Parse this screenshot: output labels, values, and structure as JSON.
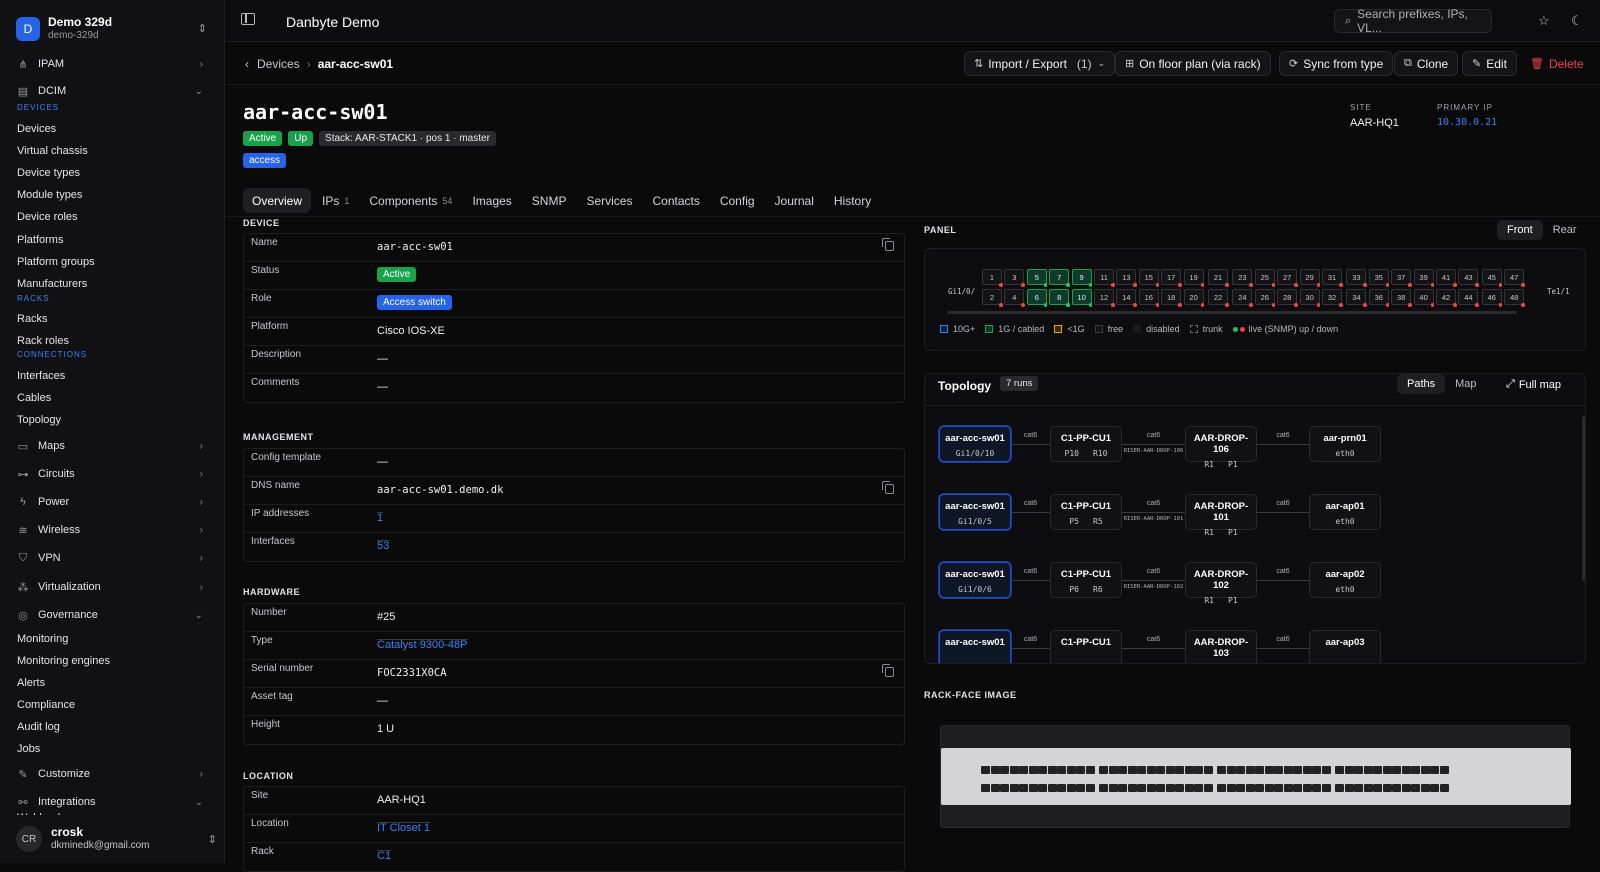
{
  "org": {
    "name": "Demo 329d",
    "slug": "demo-329d",
    "initial": "D"
  },
  "sidebar": {
    "items": [
      {
        "label": "IPAM",
        "icon": "ipam-icon",
        "type": "top",
        "chevron": "right"
      },
      {
        "label": "DCIM",
        "icon": "server-icon",
        "type": "top",
        "chevron": "down"
      },
      {
        "label": "DEVICES",
        "type": "section"
      },
      {
        "label": "Devices",
        "type": "sub"
      },
      {
        "label": "Virtual chassis",
        "type": "sub"
      },
      {
        "label": "Device types",
        "type": "sub"
      },
      {
        "label": "Module types",
        "type": "sub"
      },
      {
        "label": "Device roles",
        "type": "sub"
      },
      {
        "label": "Platforms",
        "type": "sub"
      },
      {
        "label": "Platform groups",
        "type": "sub"
      },
      {
        "label": "Manufacturers",
        "type": "sub"
      },
      {
        "label": "RACKS",
        "type": "section"
      },
      {
        "label": "Racks",
        "type": "sub"
      },
      {
        "label": "Rack roles",
        "type": "sub"
      },
      {
        "label": "CONNECTIONS",
        "type": "section"
      },
      {
        "label": "Interfaces",
        "type": "sub"
      },
      {
        "label": "Cables",
        "type": "sub"
      },
      {
        "label": "Topology",
        "type": "sub"
      },
      {
        "label": "Maps",
        "icon": "map-icon",
        "type": "top",
        "chevron": "right"
      },
      {
        "label": "Circuits",
        "icon": "circuit-icon",
        "type": "top",
        "chevron": "right"
      },
      {
        "label": "Power",
        "icon": "power-icon",
        "type": "top",
        "chevron": "right"
      },
      {
        "label": "Wireless",
        "icon": "wireless-icon",
        "type": "top",
        "chevron": "right"
      },
      {
        "label": "VPN",
        "icon": "shield-icon",
        "type": "top",
        "chevron": "right"
      },
      {
        "label": "Virtualization",
        "icon": "cluster-icon",
        "type": "top",
        "chevron": "right"
      },
      {
        "label": "Governance",
        "icon": "governance-icon",
        "type": "top",
        "chevron": "down"
      },
      {
        "label": "Monitoring",
        "type": "sub"
      },
      {
        "label": "Monitoring engines",
        "type": "sub"
      },
      {
        "label": "Alerts",
        "type": "sub"
      },
      {
        "label": "Compliance",
        "type": "sub"
      },
      {
        "label": "Audit log",
        "type": "sub"
      },
      {
        "label": "Jobs",
        "type": "sub"
      },
      {
        "label": "Customize",
        "icon": "customize-icon",
        "type": "top",
        "chevron": "right"
      },
      {
        "label": "Integrations",
        "icon": "integrations-icon",
        "type": "top",
        "chevron": "down"
      },
      {
        "label": "Webhooks",
        "type": "sub"
      }
    ]
  },
  "user": {
    "initials": "CR",
    "name": "crosk",
    "email": "dkminedk@gmail.com"
  },
  "topbar": {
    "title": "Danbyte Demo",
    "search_placeholder": "Search prefixes, IPs, VL..."
  },
  "breadcrumb": {
    "parent": "Devices",
    "current": "aar-acc-sw01"
  },
  "actions": {
    "import_export": "Import / Export",
    "import_count": "(1)",
    "floor_plan": "On floor plan (via rack)",
    "sync": "Sync from type",
    "clone": "Clone",
    "edit": "Edit",
    "delete": "Delete"
  },
  "device": {
    "name": "aar-acc-sw01",
    "badges": [
      "Active",
      "Up",
      "Stack: AAR-STACK1 · pos 1 · master"
    ],
    "tag": "access",
    "site_label": "SITE",
    "site": "AAR-HQ1",
    "ip_label": "PRIMARY IP",
    "ip": "10.30.0.21"
  },
  "tabs": [
    {
      "label": "Overview",
      "count": ""
    },
    {
      "label": "IPs",
      "count": "1"
    },
    {
      "label": "Components",
      "count": "54"
    },
    {
      "label": "Images",
      "count": ""
    },
    {
      "label": "SNMP",
      "count": ""
    },
    {
      "label": "Services",
      "count": ""
    },
    {
      "label": "Contacts",
      "count": ""
    },
    {
      "label": "Config",
      "count": ""
    },
    {
      "label": "Journal",
      "count": ""
    },
    {
      "label": "History",
      "count": ""
    }
  ],
  "sections": {
    "device": {
      "title": "DEVICE",
      "rows": [
        {
          "k": "Name",
          "v": "aar-acc-sw01",
          "mono": true,
          "copy": true
        },
        {
          "k": "Status",
          "v": "Active",
          "pill": "green"
        },
        {
          "k": "Role",
          "v": "Access switch",
          "pill": "blue"
        },
        {
          "k": "Platform",
          "v": "Cisco IOS-XE"
        },
        {
          "k": "Description",
          "v": "—"
        },
        {
          "k": "Comments",
          "v": "—"
        }
      ]
    },
    "management": {
      "title": "MANAGEMENT",
      "rows": [
        {
          "k": "Config template",
          "v": "—"
        },
        {
          "k": "DNS name",
          "v": "aar-acc-sw01.demo.dk",
          "mono": true,
          "copy": true
        },
        {
          "k": "IP addresses",
          "v": "1",
          "link": true
        },
        {
          "k": "Interfaces",
          "v": "53",
          "link": true
        }
      ]
    },
    "hardware": {
      "title": "HARDWARE",
      "rows": [
        {
          "k": "Number",
          "v": "#25"
        },
        {
          "k": "Type",
          "v": "Catalyst 9300-48P",
          "link": true
        },
        {
          "k": "Serial number",
          "v": "FOC2331X0CA",
          "mono": true,
          "copy": true
        },
        {
          "k": "Asset tag",
          "v": "—"
        },
        {
          "k": "Height",
          "v": "1 U"
        }
      ]
    },
    "location": {
      "title": "LOCATION",
      "rows": [
        {
          "k": "Site",
          "v": "AAR-HQ1"
        },
        {
          "k": "Location",
          "v": "IT Closet 1",
          "link": true
        },
        {
          "k": "Rack",
          "v": "C1",
          "link": true
        }
      ]
    }
  },
  "panel": {
    "title": "PANEL",
    "front": "Front",
    "rear": "Rear",
    "left_label": "Gi1/0/",
    "right_label": "Te1/1",
    "cabled_ports": [
      5,
      6,
      7,
      8,
      9,
      10
    ],
    "legend": [
      "10G+",
      "1G / cabled",
      "<1G",
      "free",
      "disabled",
      "trunk",
      "live (SNMP) up / down"
    ],
    "colors": {
      "up": "#22c55e",
      "down": "#ef4444",
      "cabled": "#16a34a",
      "tenG": "#3b82f6",
      "slow": "#f59e0b"
    }
  },
  "topology": {
    "title": "Topology",
    "runs": "7 runs",
    "paths": "Paths",
    "map": "Map",
    "full_map": "Full map",
    "rows": [
      {
        "sw": "aar-acc-sw01",
        "sw_port": "Gi1/0/10",
        "pp": "C1-PP-CU1",
        "pp_p": [
          "P10",
          "R10"
        ],
        "riser": "RISER-AAR-DROP-106",
        "drop": "AAR-DROP-106",
        "drop_p": [
          "R1",
          "P1"
        ],
        "end": "aar-prn01",
        "end_p": "eth0"
      },
      {
        "sw": "aar-acc-sw01",
        "sw_port": "Gi1/0/5",
        "pp": "C1-PP-CU1",
        "pp_p": [
          "P5",
          "R5"
        ],
        "riser": "RISER-AAR-DROP-101",
        "drop": "AAR-DROP-101",
        "drop_p": [
          "R1",
          "P1"
        ],
        "end": "aar-ap01",
        "end_p": "eth0"
      },
      {
        "sw": "aar-acc-sw01",
        "sw_port": "Gi1/0/6",
        "pp": "C1-PP-CU1",
        "pp_p": [
          "P6",
          "R6"
        ],
        "riser": "RISER-AAR-DROP-102",
        "drop": "AAR-DROP-102",
        "drop_p": [
          "R1",
          "P1"
        ],
        "end": "aar-ap02",
        "end_p": "eth0"
      },
      {
        "sw": "aar-acc-sw01",
        "sw_port": "",
        "pp": "C1-PP-CU1",
        "pp_p": [
          "",
          ""
        ],
        "riser": "",
        "drop": "AAR-DROP-103",
        "drop_p": [
          "",
          ""
        ],
        "end": "aar-ap03",
        "end_p": ""
      }
    ],
    "cable": "cat6"
  },
  "rack_face": {
    "title": "RACK-FACE IMAGE"
  }
}
